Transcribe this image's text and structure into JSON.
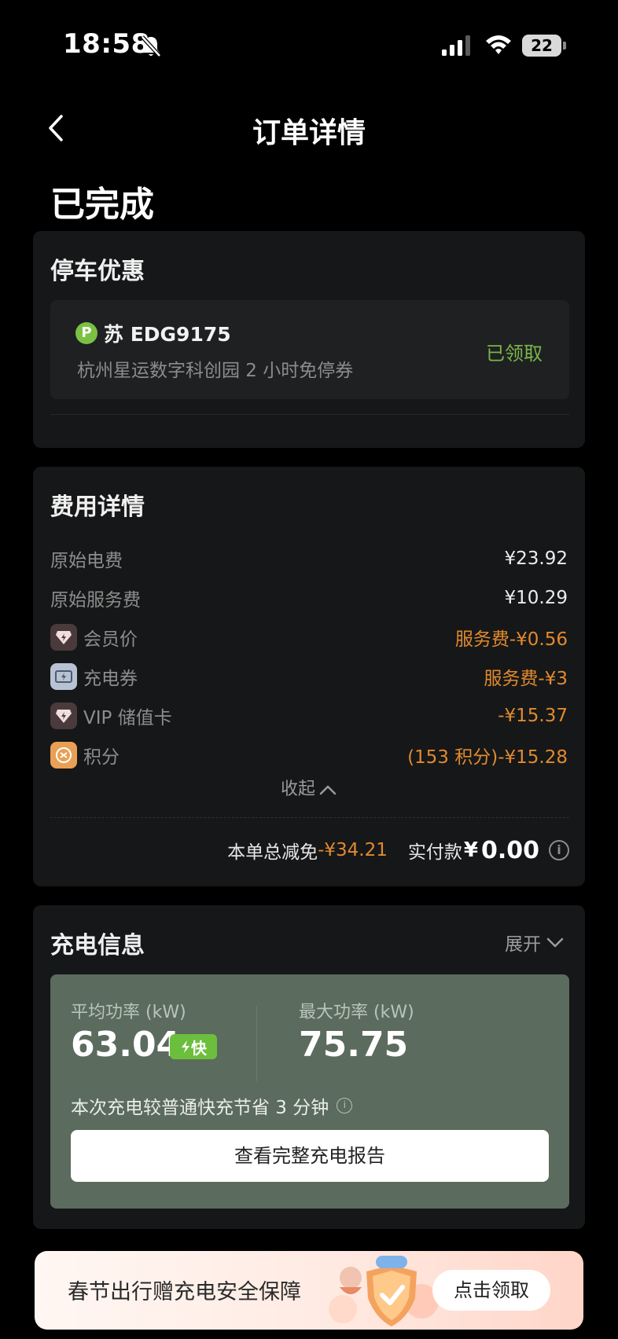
{
  "status_bar": {
    "time": "18:58",
    "battery": "22"
  },
  "nav": {
    "title": "订单详情"
  },
  "order": {
    "status": "已完成"
  },
  "parking": {
    "title": "停车优惠",
    "badge": "P",
    "plate": "苏 EDG9175",
    "coupon": "杭州星运数字科创园 2 小时免停券",
    "claim_status": "已领取"
  },
  "fees": {
    "title": "费用详情",
    "items": [
      {
        "label": "原始电费",
        "value": "¥23.92",
        "icon": ""
      },
      {
        "label": "原始服务费",
        "value": "¥10.29",
        "icon": ""
      },
      {
        "label": "会员价",
        "value": "服务费-¥0.56",
        "icon": "member-diamond-icon"
      },
      {
        "label": "充电券",
        "value": "服务费-¥3",
        "icon": "charge-coupon-icon"
      },
      {
        "label": "VIP 储值卡",
        "value": "-¥15.37",
        "icon": "vip-card-icon"
      },
      {
        "label": "积分",
        "value": "(153 积分)-¥15.28",
        "icon": "points-icon"
      }
    ],
    "collapse_label": "收起",
    "total_discount_label": "本单总减免",
    "total_discount_value": "-¥34.21",
    "paid_label": "实付款",
    "paid_currency": "¥",
    "paid_value": "0.00",
    "accent": "#e08a2e"
  },
  "charging": {
    "title": "充电信息",
    "expand_label": "展开",
    "avg_power_label": "平均功率 (kW)",
    "avg_power_value": "63.04",
    "fast_badge": "快",
    "max_power_label": "最大功率 (kW)",
    "max_power_value": "75.75",
    "saving_text": "本次充电较普通快充节省 3 分钟",
    "report_button": "查看完整充电报告",
    "panel_color": "#5b6b5d"
  },
  "promo": {
    "text": "春节出行赠充电安全保障",
    "button": "点击领取"
  }
}
